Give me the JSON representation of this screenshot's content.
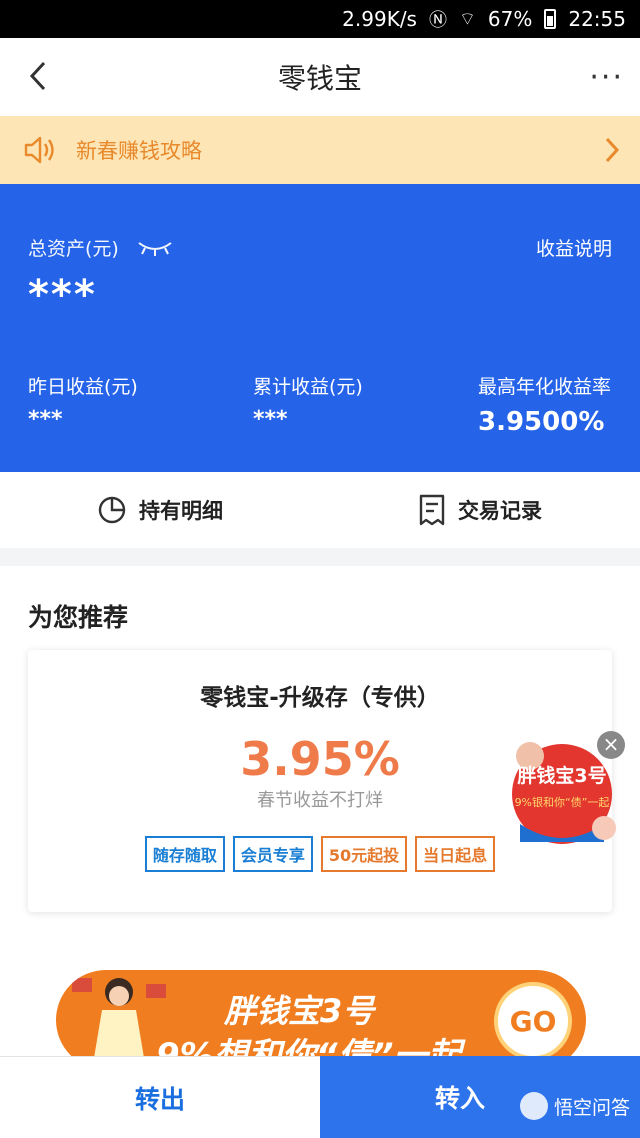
{
  "status_bar": {
    "speed": "2.99K/s",
    "battery": "67%",
    "time": "22:55"
  },
  "nav": {
    "title": "零钱宝"
  },
  "notice": {
    "text": "新春赚钱攻略"
  },
  "asset": {
    "total_label": "总资产(元)",
    "explain_label": "收益说明",
    "total_value": "***",
    "yesterday_label": "昨日收益(元)",
    "yesterday_value": "***",
    "cumulative_label": "累计收益(元)",
    "cumulative_value": "***",
    "max_rate_label": "最高年化收益率",
    "max_rate_value": "3.9500%"
  },
  "actions": {
    "holdings_label": "持有明细",
    "records_label": "交易记录"
  },
  "recommend": {
    "title": "为您推荐",
    "card": {
      "name": "零钱宝-升级存（专供）",
      "rate": "3.95%",
      "sub": "春节收益不打烊",
      "tags": [
        "随存随取",
        "会员专享",
        "50元起投",
        "当日起息"
      ]
    }
  },
  "float_ad": {
    "title": "胖钱宝3号",
    "sub": "9%银和你“债”一起"
  },
  "banner": {
    "line1": "胖钱宝3号",
    "line2": "9%想和你“债”一起",
    "go": "GO"
  },
  "bottom": {
    "out_label": "转出",
    "in_label": "转入"
  },
  "watermark": {
    "text": "悟空问答"
  },
  "colors": {
    "primary": "#2563e8",
    "accent": "#f07b4a",
    "notice_bg": "#fde5b5",
    "notice_text": "#e8892b"
  }
}
